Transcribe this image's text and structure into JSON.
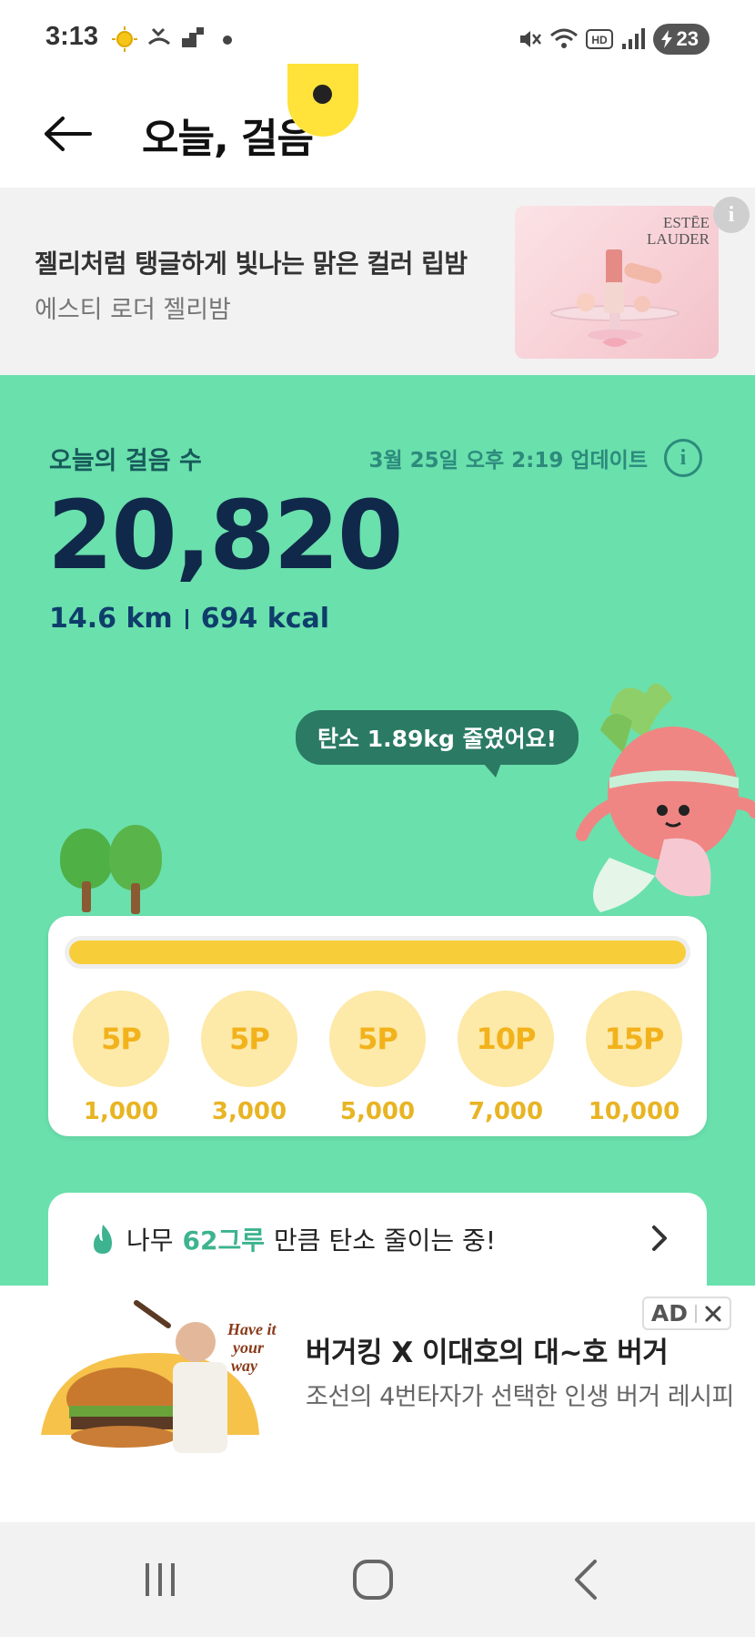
{
  "status_bar": {
    "time": "3:13",
    "battery": "23"
  },
  "header": {
    "title": "오늘, 걸음"
  },
  "top_ad": {
    "title": "젤리처럼 탱글하게 빛나는 맑은 컬러 립밤",
    "subtitle": "에스티 로더 젤리밤",
    "brand_line1": "ESTĒE",
    "brand_line2": "LAUDER"
  },
  "steps": {
    "label": "오늘의 걸음 수",
    "updated": "3월 25일 오후 2:19 업데이트",
    "count": "20,820",
    "distance": "14.6 km",
    "calories": "694 kcal",
    "carbon_message": "탄소 1.89kg 줄였어요!"
  },
  "progress": {
    "fill_fraction": 1.0,
    "milestones": [
      {
        "points": "5P",
        "steps": "1,000"
      },
      {
        "points": "5P",
        "steps": "3,000"
      },
      {
        "points": "5P",
        "steps": "5,000"
      },
      {
        "points": "10P",
        "steps": "7,000"
      },
      {
        "points": "15P",
        "steps": "10,000"
      }
    ]
  },
  "tree_banner": {
    "prefix": "나무",
    "count": "62그루",
    "suffix": "만큼 탄소 줄이는 중!"
  },
  "bottom_ad": {
    "label": "AD",
    "title": "버거킹 X 이대호의 대~호 버거",
    "subtitle": "조선의 4번타자가 선택한 인생 버거 레시피"
  },
  "colors": {
    "main_green": "#6ae0ad",
    "progress_yellow": "#f7cd3a",
    "steps_navy": "#10294a"
  }
}
